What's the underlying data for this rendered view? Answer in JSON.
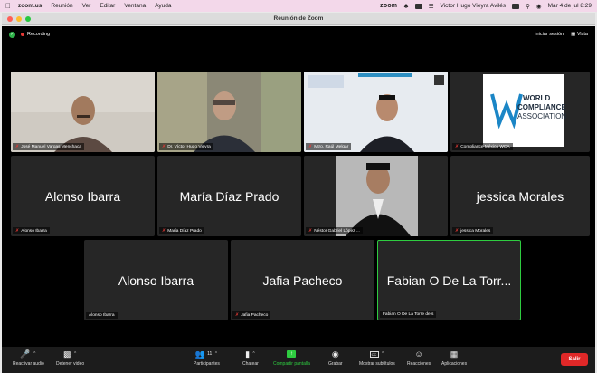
{
  "menubar": {
    "app": "zoom.us",
    "items": [
      "Reunión",
      "Ver",
      "Editar",
      "Ventana",
      "Ayuda"
    ],
    "tray_app": "zoom",
    "user": "Victor Hugo Vieyra Avilés",
    "datetime": "Mar 4 de jul  8:29"
  },
  "window": {
    "title": "Reunión de Zoom"
  },
  "meeting": {
    "recording": "Recording",
    "sign_in": "Iniciar sesión",
    "view": "Vista"
  },
  "participants": [
    {
      "name": "José Manuel Vargas Menchaca",
      "type": "video"
    },
    {
      "name": "Dr. Víctor Hugo Vieyra",
      "type": "video"
    },
    {
      "name": "Mtro. Raúl Melgar",
      "type": "video"
    },
    {
      "name": "Compliance México WCA",
      "type": "logo",
      "logo_lines": [
        "WORLD",
        "COMPLIANCE",
        "ASSOCIATION"
      ]
    },
    {
      "name": "Alonso Ibarra",
      "display": "Alonso Ibarra",
      "type": "name"
    },
    {
      "name": "María Díaz Prado",
      "display": "María Díaz Prado",
      "type": "name"
    },
    {
      "name": "Néstor Gabriel López ...",
      "type": "photo"
    },
    {
      "name": "jessica Morales",
      "display": "jessica Morales",
      "type": "name"
    },
    {
      "name": "Alonso Ibarra",
      "display": "Alonso Ibarra",
      "type": "name"
    },
    {
      "name": "Jafia Pacheco",
      "display": "Jafia Pacheco",
      "type": "name"
    },
    {
      "name": "Fabian O De La Torre de s",
      "display": "Fabian O De La Torr...",
      "type": "name"
    }
  ],
  "toolbar": {
    "mute": "Reactivar audio",
    "video": "Detener video",
    "participants": "Participantes",
    "participants_count": "11",
    "chat": "Chatear",
    "share": "Compartir pantalla",
    "record": "Grabar",
    "captions": "Mostrar subtítulos",
    "reactions": "Reacciones",
    "apps": "Aplicaciones",
    "leave": "Salir"
  },
  "colors": {
    "active_speaker": "#2ecc40",
    "leave": "#e02828",
    "menubar": "#f3d8ea"
  }
}
